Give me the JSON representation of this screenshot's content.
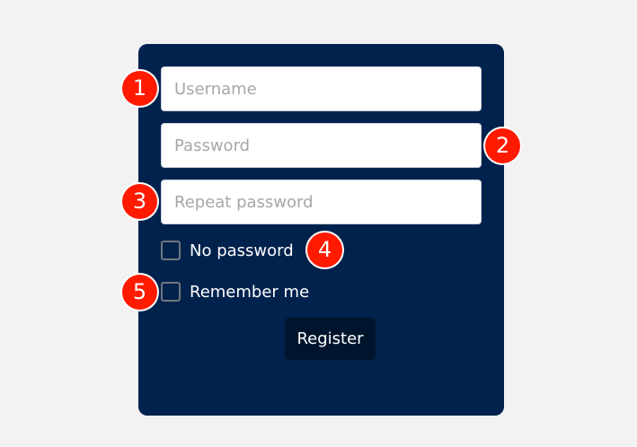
{
  "form": {
    "username": {
      "value": "",
      "placeholder": "Username"
    },
    "password": {
      "value": "",
      "placeholder": "Password"
    },
    "repeat_password": {
      "value": "",
      "placeholder": "Repeat password"
    },
    "no_password": {
      "label": "No password",
      "checked": false
    },
    "remember_me": {
      "label": "Remember me",
      "checked": false
    },
    "register_label": "Register"
  },
  "markers": [
    "1",
    "2",
    "3",
    "4",
    "5"
  ],
  "colors": {
    "page_background": "#f2f2f2",
    "panel_background": "#00224d",
    "button_background": "#00152d",
    "marker_background": "#ff1a00"
  }
}
